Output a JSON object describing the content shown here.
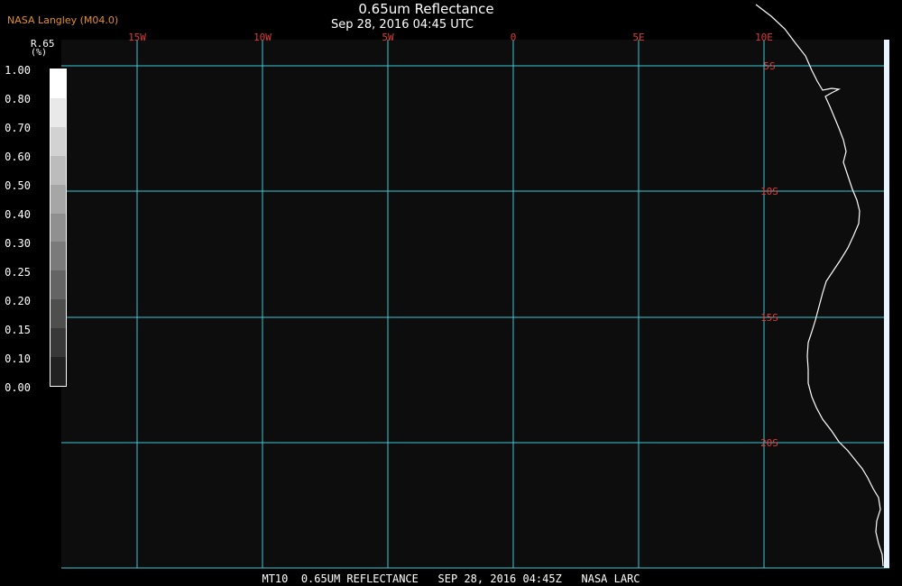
{
  "header": {
    "producer": "NASA Langley (M04.0)",
    "title": "0.65um Reflectance",
    "subtitle": "Sep 28, 2016 04:45 UTC"
  },
  "colorbar": {
    "variable": "R.65",
    "units": "(%)",
    "ticks": [
      "1.00",
      "0.80",
      "0.70",
      "0.60",
      "0.50",
      "0.40",
      "0.30",
      "0.25",
      "0.20",
      "0.15",
      "0.10",
      "0.00"
    ],
    "shades": [
      "#ffffff",
      "#e9e9e9",
      "#d2d2d2",
      "#bcbcbc",
      "#a6a6a6",
      "#909090",
      "#7a7a7a",
      "#646464",
      "#4e4e4e",
      "#383838",
      "#222222"
    ]
  },
  "map": {
    "longitude_labels": [
      "15W",
      "10W",
      "5W",
      "0",
      "5E",
      "10E"
    ],
    "latitude_labels": [
      "5S",
      "10S",
      "15S",
      "20S"
    ],
    "grid_color": "#3cc8d2",
    "label_color": "#e03a3a",
    "coastline_color": "#ffffff",
    "background_color": "#0d0d0d"
  },
  "footer": {
    "text": "MT10  0.65UM REFLECTANCE   SEP 28, 2016 04:45Z   NASA LARC"
  }
}
